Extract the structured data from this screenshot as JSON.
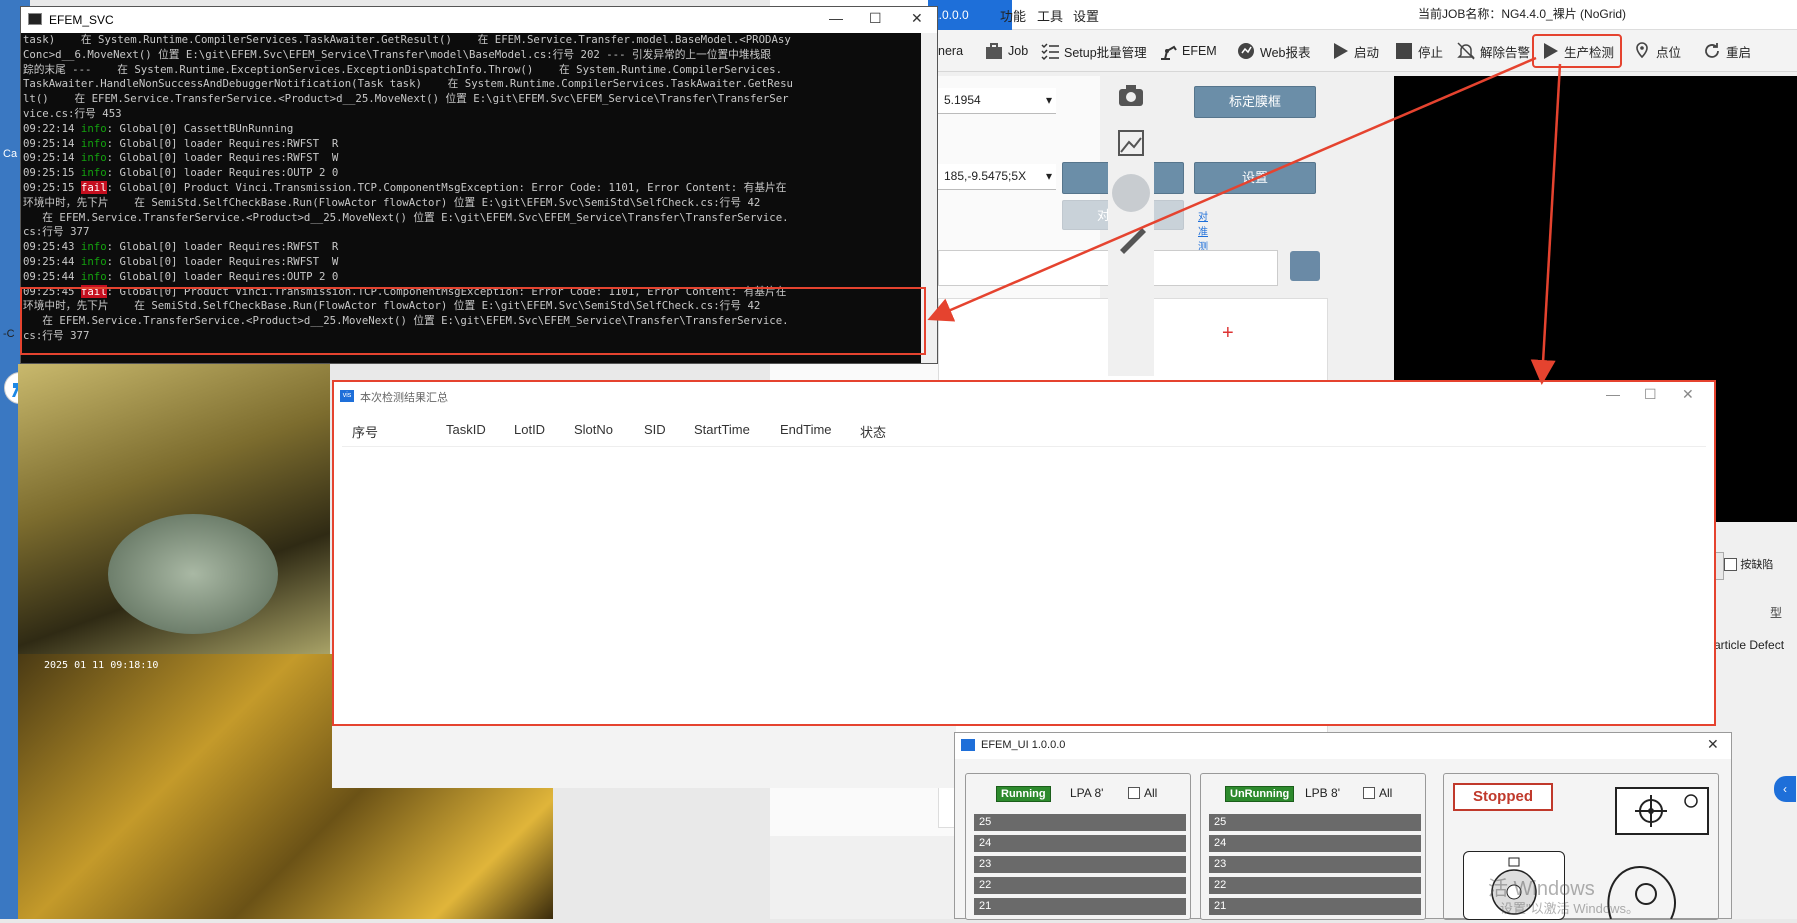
{
  "desktop": {
    "left_label_1": "Ca",
    "left_label_2": "-C"
  },
  "main_app": {
    "version": "1.0.0.0",
    "menus": [
      "功能",
      "工具",
      "设置"
    ],
    "job_name": "当前JOB名称：NG4.4.0_裸片 (NoGrid)",
    "toolbar": [
      {
        "label": "nera",
        "icon": "camera-icon"
      },
      {
        "label": "Job",
        "icon": "briefcase-icon"
      },
      {
        "label": "Setup批量管理",
        "icon": "checklist-icon"
      },
      {
        "label": "EFEM",
        "icon": "robot-arm-icon"
      },
      {
        "label": "Web报表",
        "icon": "report-icon"
      },
      {
        "label": "启动",
        "icon": "play-icon"
      },
      {
        "label": "停止",
        "icon": "stop-icon"
      },
      {
        "label": "解除告警",
        "icon": "bell-off-icon"
      },
      {
        "label": "生产检测",
        "icon": "play-icon"
      },
      {
        "label": "点位",
        "icon": "location-icon"
      },
      {
        "label": "重启",
        "icon": "restart-icon"
      }
    ],
    "combo1": "5.1954",
    "combo2": "185,-9.5475;5X",
    "btn_calib": "标定膜框",
    "btn_move": "移动",
    "btn_set": "设置",
    "btn_align": "对准设置",
    "link_align_test": "对准测试",
    "right_side": {
      "checkbox_label": "按缺陷",
      "type_label": "型",
      "defect_label": "article Defect"
    }
  },
  "console": {
    "title": "EFEM_SVC",
    "lines": [
      [
        {
          "t": "task)    在 System.Runtime.CompilerServices.TaskAwaiter.GetResult()    在 EFEM.Service.Transfer.model.BaseModel.<PRODAsy"
        }
      ],
      [
        {
          "t": "Conc>d__6.MoveNext() 位置 E:\\git\\EFEM.Svc\\EFEM_Service\\Transfer\\model\\BaseModel.cs:行号 202 --- 引发异常的上一位置中堆栈跟"
        }
      ],
      [
        {
          "t": "踪的末尾 ---    在 System.Runtime.ExceptionServices.ExceptionDispatchInfo.Throw()    在 System.Runtime.CompilerServices."
        }
      ],
      [
        {
          "t": "TaskAwaiter.HandleNonSuccessAndDebuggerNotification(Task task)    在 System.Runtime.CompilerServices.TaskAwaiter.GetResu"
        }
      ],
      [
        {
          "t": "lt()    在 EFEM.Service.TransferService.<Product>d__25.MoveNext() 位置 E:\\git\\EFEM.Svc\\EFEM_Service\\Transfer\\TransferSer"
        }
      ],
      [
        {
          "t": "vice.cs:行号 453"
        }
      ],
      [
        {
          "t": "09:22:14 "
        },
        {
          "t": "info",
          "c": "info"
        },
        {
          "t": ": Global[0] CassettBUnRunning"
        }
      ],
      [
        {
          "t": "09:25:14 "
        },
        {
          "t": "info",
          "c": "info"
        },
        {
          "t": ": Global[0] loader Requires:RWFST  R"
        }
      ],
      [
        {
          "t": "09:25:14 "
        },
        {
          "t": "info",
          "c": "info"
        },
        {
          "t": ": Global[0] loader Requires:RWFST  W"
        }
      ],
      [
        {
          "t": "09:25:15 "
        },
        {
          "t": "info",
          "c": "info"
        },
        {
          "t": ": Global[0] loader Requires:OUTP 2 0"
        }
      ],
      [
        {
          "t": "09:25:15 "
        },
        {
          "t": "fail",
          "c": "fail"
        },
        {
          "t": ": Global[0] Product Vinci.Transmission.TCP.ComponentMsgException: Error Code: 1101, Error Content: 有基片在"
        }
      ],
      [
        {
          "t": "环境中时，先下片    在 SemiStd.SelfCheckBase.Run(FlowActor flowActor) 位置 E:\\git\\EFEM.Svc\\SemiStd\\SelfCheck.cs:行号 42"
        }
      ],
      [
        {
          "t": "   在 EFEM.Service.TransferService.<Product>d__25.MoveNext() 位置 E:\\git\\EFEM.Svc\\EFEM_Service\\Transfer\\TransferService."
        }
      ],
      [
        {
          "t": "cs:行号 377"
        }
      ],
      [
        {
          "t": "09:25:43 "
        },
        {
          "t": "info",
          "c": "info"
        },
        {
          "t": ": Global[0] loader Requires:RWFST  R"
        }
      ],
      [
        {
          "t": "09:25:44 "
        },
        {
          "t": "info",
          "c": "info"
        },
        {
          "t": ": Global[0] loader Requires:RWFST  W"
        }
      ],
      [
        {
          "t": "09:25:44 "
        },
        {
          "t": "info",
          "c": "info"
        },
        {
          "t": ": Global[0] loader Requires:OUTP 2 0"
        }
      ],
      [
        {
          "t": "09:25:45 "
        },
        {
          "t": "fail",
          "c": "fail"
        },
        {
          "t": ": Global[0] Product Vinci.Transmission.TCP.ComponentMsgException: Error Code: 1101, Error Content: 有基片在"
        }
      ],
      [
        {
          "t": "环境中时，先下片    在 SemiStd.SelfCheckBase.Run(FlowActor flowActor) 位置 E:\\git\\EFEM.Svc\\SemiStd\\SelfCheck.cs:行号 42"
        }
      ],
      [
        {
          "t": "   在 EFEM.Service.TransferService.<Product>d__25.MoveNext() 位置 E:\\git\\EFEM.Svc\\EFEM_Service\\Transfer\\TransferService."
        }
      ],
      [
        {
          "t": "cs:行号 377"
        }
      ]
    ]
  },
  "camera": {
    "timestamp": "2025 01 11 09:18:10"
  },
  "summary": {
    "title": "本次检测结果汇总",
    "columns": [
      "序号",
      "TaskID",
      "LotID",
      "SlotNo",
      "SID",
      "StartTime",
      "EndTime",
      "状态"
    ]
  },
  "efem_ui": {
    "title": "EFEM_UI 1.0.0.0",
    "lpa": {
      "status": "Running",
      "label": "LPA  8'",
      "all": "All",
      "slots": [
        "25",
        "24",
        "23",
        "22",
        "21"
      ]
    },
    "lpb": {
      "status": "UnRunning",
      "label": "LPB  8'",
      "all": "All",
      "slots": [
        "25",
        "24",
        "23",
        "22",
        "21"
      ]
    },
    "stopped": "Stopped"
  },
  "watermark": {
    "line1": "活 Windows",
    "line2": "设置\"以激活 Windows。"
  },
  "colors": {
    "accent_red": "#e5432f",
    "running_green": "#2d8a2d",
    "slot_gray": "#6a6a6a",
    "console_bg": "#0c0c0c",
    "version_blue": "#1e6fd9"
  }
}
